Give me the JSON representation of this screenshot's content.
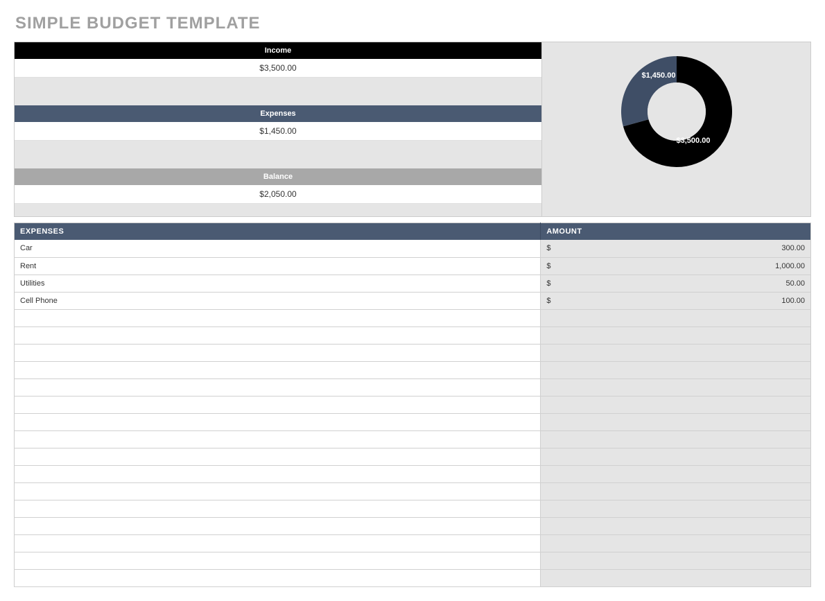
{
  "title": "SIMPLE BUDGET TEMPLATE",
  "summary": {
    "income_label": "Income",
    "income_value": "$3,500.00",
    "expenses_label": "Expenses",
    "expenses_value": "$1,450.00",
    "balance_label": "Balance",
    "balance_value": "$2,050.00"
  },
  "chart_data": {
    "type": "pie",
    "title": "",
    "series": [
      {
        "name": "Income",
        "value": 3500,
        "label": "$3,500.00",
        "color": "#000000"
      },
      {
        "name": "Expenses",
        "value": 1450,
        "label": "$1,450.00",
        "color": "#3f4e66"
      }
    ]
  },
  "table": {
    "header_expenses": "EXPENSES",
    "header_amount": "AMOUNT",
    "currency_symbol": "$",
    "rows": [
      {
        "name": "Car",
        "amount": "300.00"
      },
      {
        "name": "Rent",
        "amount": "1,000.00"
      },
      {
        "name": "Utilities",
        "amount": "50.00"
      },
      {
        "name": "Cell Phone",
        "amount": "100.00"
      },
      {
        "name": "",
        "amount": ""
      },
      {
        "name": "",
        "amount": ""
      },
      {
        "name": "",
        "amount": ""
      },
      {
        "name": "",
        "amount": ""
      },
      {
        "name": "",
        "amount": ""
      },
      {
        "name": "",
        "amount": ""
      },
      {
        "name": "",
        "amount": ""
      },
      {
        "name": "",
        "amount": ""
      },
      {
        "name": "",
        "amount": ""
      },
      {
        "name": "",
        "amount": ""
      },
      {
        "name": "",
        "amount": ""
      },
      {
        "name": "",
        "amount": ""
      },
      {
        "name": "",
        "amount": ""
      },
      {
        "name": "",
        "amount": ""
      },
      {
        "name": "",
        "amount": ""
      },
      {
        "name": "",
        "amount": ""
      }
    ]
  }
}
